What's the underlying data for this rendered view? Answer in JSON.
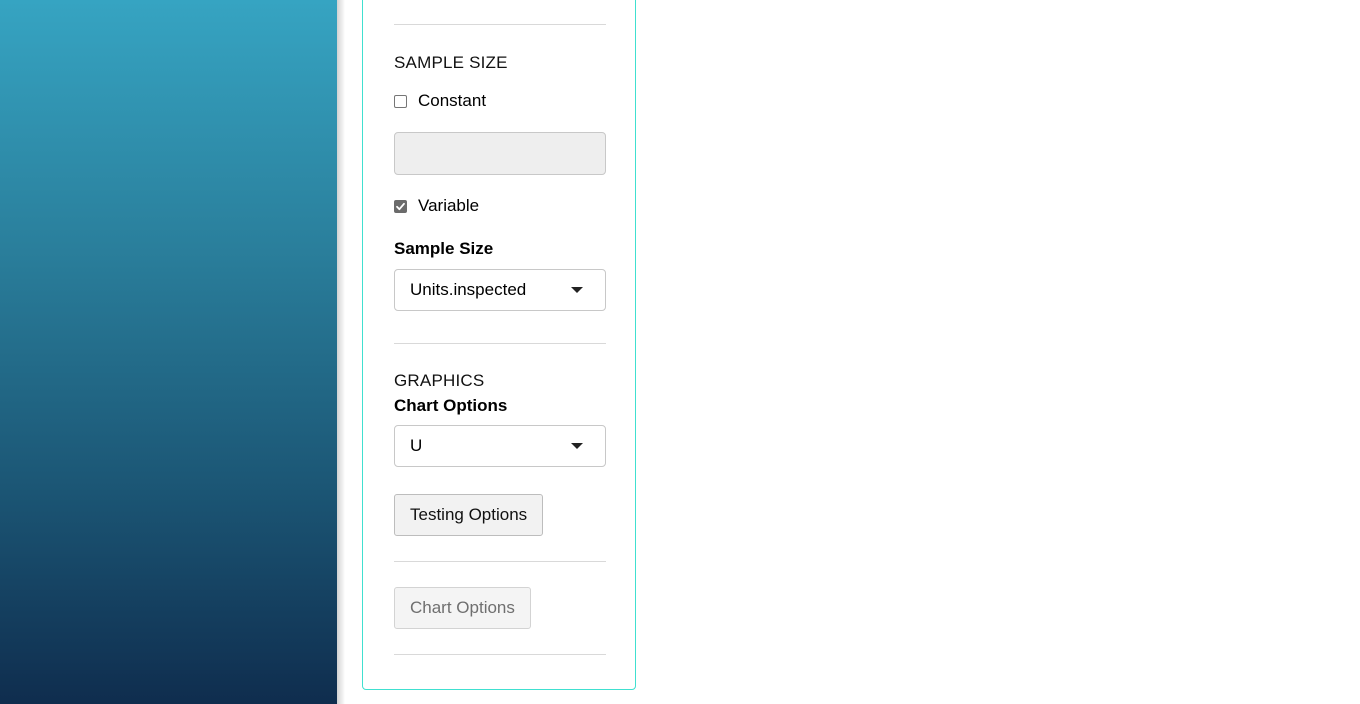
{
  "sample_size": {
    "section_title": "SAMPLE SIZE",
    "constant_label": "Constant",
    "constant_checked": false,
    "constant_value": "",
    "variable_label": "Variable",
    "variable_checked": true,
    "field_label": "Sample Size",
    "selected_value": "Units.inspected"
  },
  "graphics": {
    "section_title": "GRAPHICS",
    "chart_options_label": "Chart Options",
    "chart_options_value": "U",
    "testing_options_button": "Testing Options",
    "chart_options_button": "Chart Options"
  },
  "colors": {
    "panel_border": "#40e0d0",
    "sidebar_top": "#36a4c2",
    "sidebar_bottom": "#0f2d4e"
  }
}
